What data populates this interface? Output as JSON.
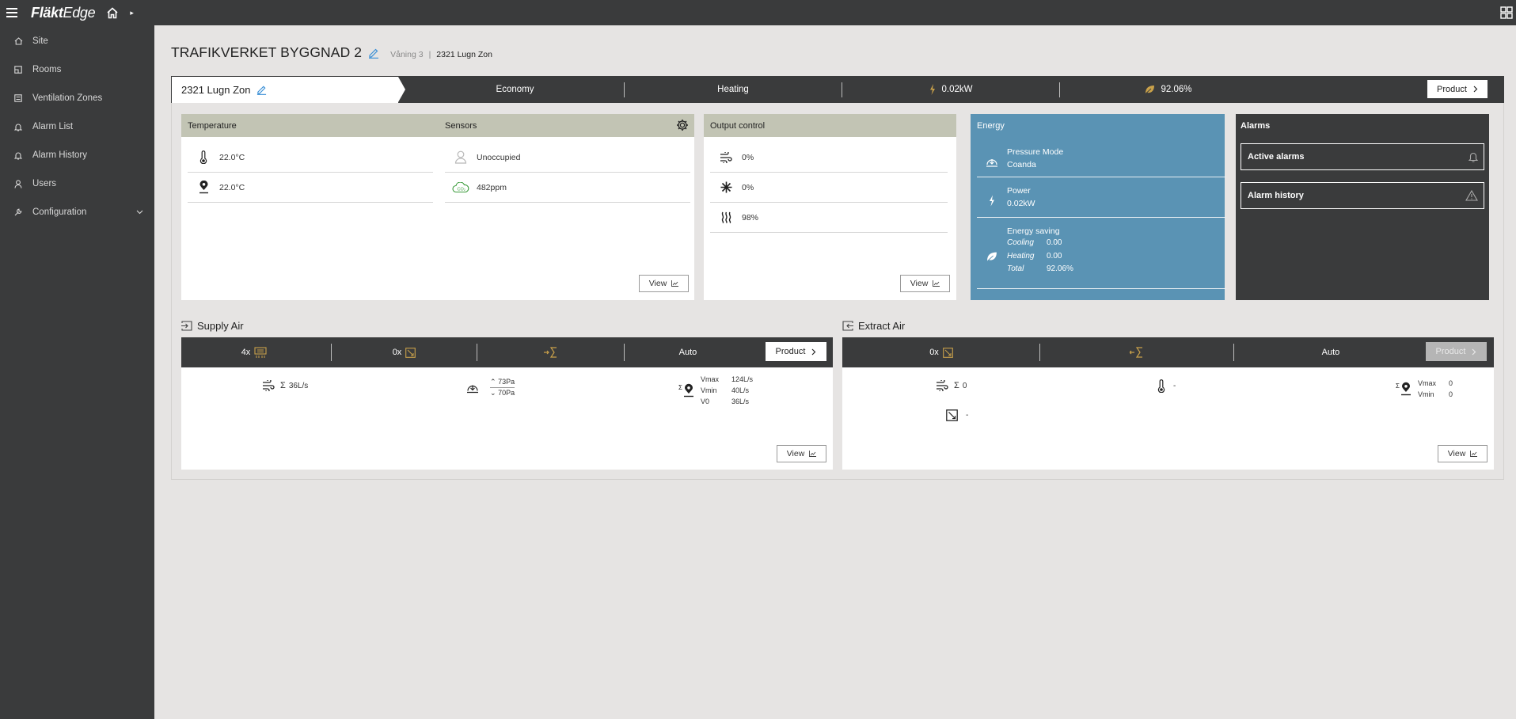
{
  "app": {
    "brand_bold": "Fläkt",
    "brand_light": "Edge"
  },
  "sidebar": {
    "items": [
      {
        "label": "Site",
        "icon": "home-icon"
      },
      {
        "label": "Rooms",
        "icon": "rooms-icon"
      },
      {
        "label": "Ventilation Zones",
        "icon": "zones-icon"
      },
      {
        "label": "Alarm List",
        "icon": "bell-icon"
      },
      {
        "label": "Alarm History",
        "icon": "bell-icon"
      },
      {
        "label": "Users",
        "icon": "user-icon"
      },
      {
        "label": "Configuration",
        "icon": "wrench-icon"
      }
    ]
  },
  "header": {
    "title": "TRAFIKVERKET BYGGNAD 2",
    "level": "Våning 3",
    "separator": "|",
    "zone": "2321 Lugn Zon"
  },
  "zonebar": {
    "zone_name": "2321 Lugn Zon",
    "mode": "Economy",
    "state": "Heating",
    "power": "0.02kW",
    "saving": "92.06%",
    "product_label": "Product"
  },
  "temperature_card": {
    "title": "Temperature",
    "rows": [
      "22.0°C",
      "22.0°C"
    ],
    "sensors_title": "Sensors",
    "sensors": [
      "Unoccupied",
      "482ppm"
    ],
    "co2_badge": "CO₂",
    "view_label": "View"
  },
  "output_card": {
    "title": "Output control",
    "rows": [
      "0%",
      "0%",
      "98%"
    ],
    "view_label": "View"
  },
  "energy_card": {
    "title": "Energy",
    "pressure_label": "Pressure Mode",
    "pressure_value": "Coanda",
    "power_label": "Power",
    "power_value": "0.02kW",
    "saving_label": "Energy saving",
    "cooling_label": "Cooling",
    "cooling_value": "0.00",
    "heating_label": "Heating",
    "heating_value": "0.00",
    "total_label": "Total",
    "total_value": "92.06%"
  },
  "alarms_card": {
    "title": "Alarms",
    "active_label": "Active alarms",
    "history_label": "Alarm history"
  },
  "supply_air": {
    "title": "Supply Air",
    "count_a": "4x",
    "count_b": "0x",
    "mode": "Auto",
    "product_label": "Product",
    "sigma": "Σ",
    "flow": "36L/s",
    "pressure_up": "73Pa",
    "pressure_down": "70Pa",
    "vmax_label": "Vmax",
    "vmax_value": "124L/s",
    "vmin_label": "Vmin",
    "vmin_value": "40L/s",
    "v0_label": "V0",
    "v0_value": "36L/s",
    "view_label": "View"
  },
  "extract_air": {
    "title": "Extract Air",
    "count_b": "0x",
    "mode": "Auto",
    "product_label": "Product",
    "sigma": "Σ",
    "flow": "0",
    "temp": "-",
    "damper": "-",
    "vmax_label": "Vmax",
    "vmax_value": "0",
    "vmin_label": "Vmin",
    "vmin_value": "0",
    "view_label": "View"
  },
  "colors": {
    "sidebar_bg": "#3a3b3c",
    "page_bg": "#e6e4e3",
    "card_header": "#c2c4b4",
    "energy_bg": "#5a93b4",
    "accent_gold": "#c9a14a",
    "edit_blue": "#3a8fd6"
  }
}
